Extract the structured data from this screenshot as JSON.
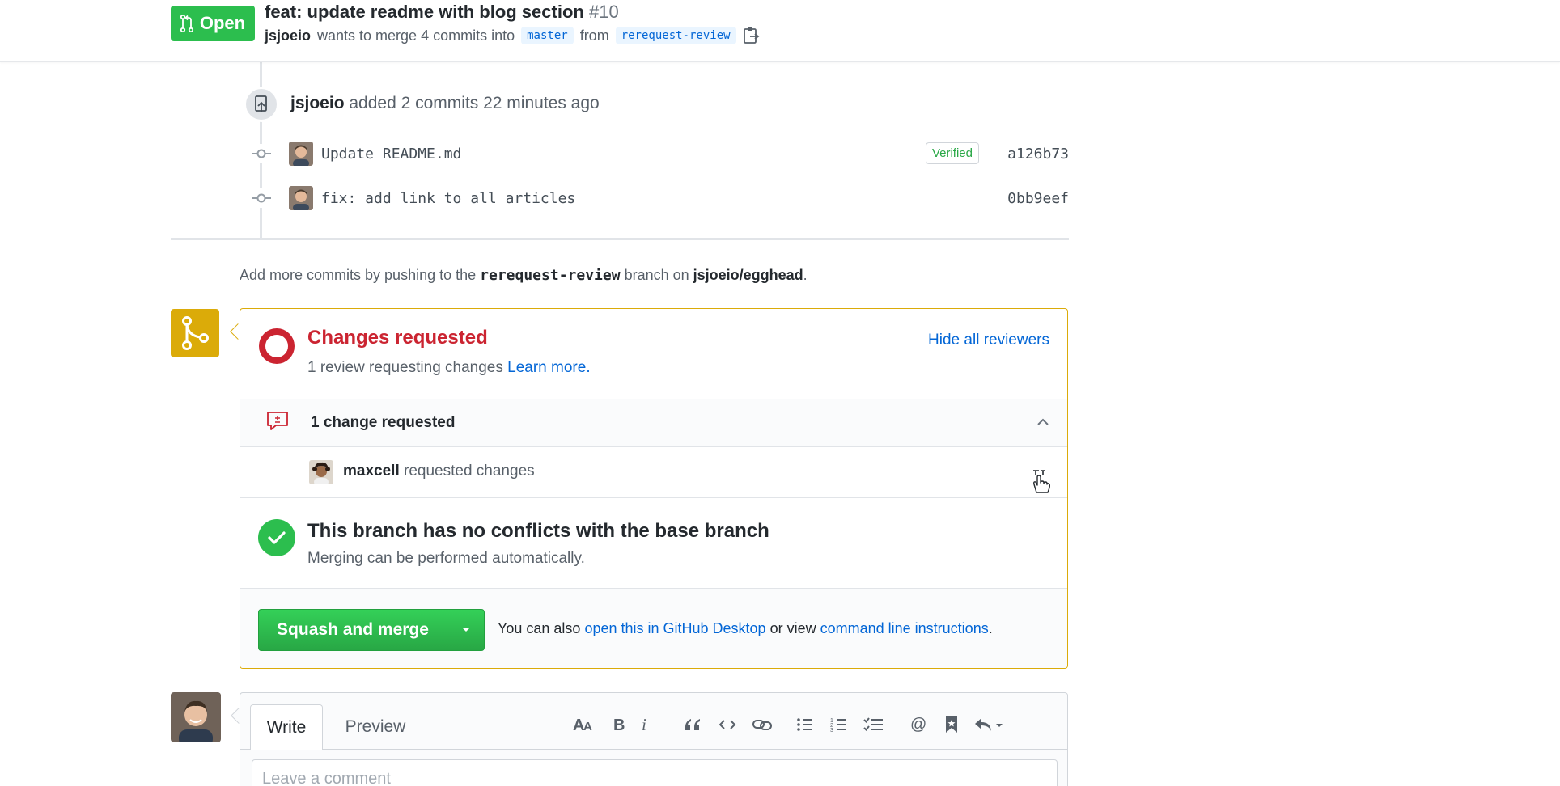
{
  "pr": {
    "state": "Open",
    "title": "feat: update readme with blog section",
    "number": "#10",
    "author": "jsjoeio",
    "merge_text_1": "wants to merge 4 commits into",
    "base_branch": "master",
    "from_text": "from",
    "head_branch": "rerequest-review"
  },
  "timeline": {
    "push_author": "jsjoeio",
    "push_text": "added 2 commits 22 minutes ago",
    "commits": [
      {
        "message": "Update README.md",
        "verified": "Verified",
        "sha": "a126b73"
      },
      {
        "message": "fix: add link to all articles",
        "verified": "",
        "sha": "0bb9eef"
      }
    ],
    "push_hint_1": "Add more commits by pushing to the",
    "push_hint_branch": "rerequest-review",
    "push_hint_2": "branch on",
    "push_hint_repo": "jsjoeio/egghead",
    "push_hint_end": "."
  },
  "merge_box": {
    "review_title": "Changes requested",
    "review_sub": "1 review requesting changes",
    "learn_more": "Learn more.",
    "hide_reviewers": "Hide all reviewers",
    "change_count": "1 change requested",
    "reviewer_name": "maxcell",
    "reviewer_action": "requested changes",
    "conflicts_title": "This branch has no conflicts with the base branch",
    "conflicts_sub": "Merging can be performed automatically.",
    "merge_button": "Squash and merge",
    "also_text_1": "You can also",
    "desktop_link": "open this in GitHub Desktop",
    "also_text_2": "or view",
    "cli_link": "command line instructions",
    "also_text_end": "."
  },
  "comment": {
    "tab_write": "Write",
    "tab_preview": "Preview",
    "placeholder": "Leave a comment"
  },
  "colors": {
    "open_green": "#2cbe4e",
    "requested_red": "#cb2431",
    "warning_yellow": "#dbab09",
    "link_blue": "#0366d6",
    "success_green": "#2cbe4e"
  }
}
